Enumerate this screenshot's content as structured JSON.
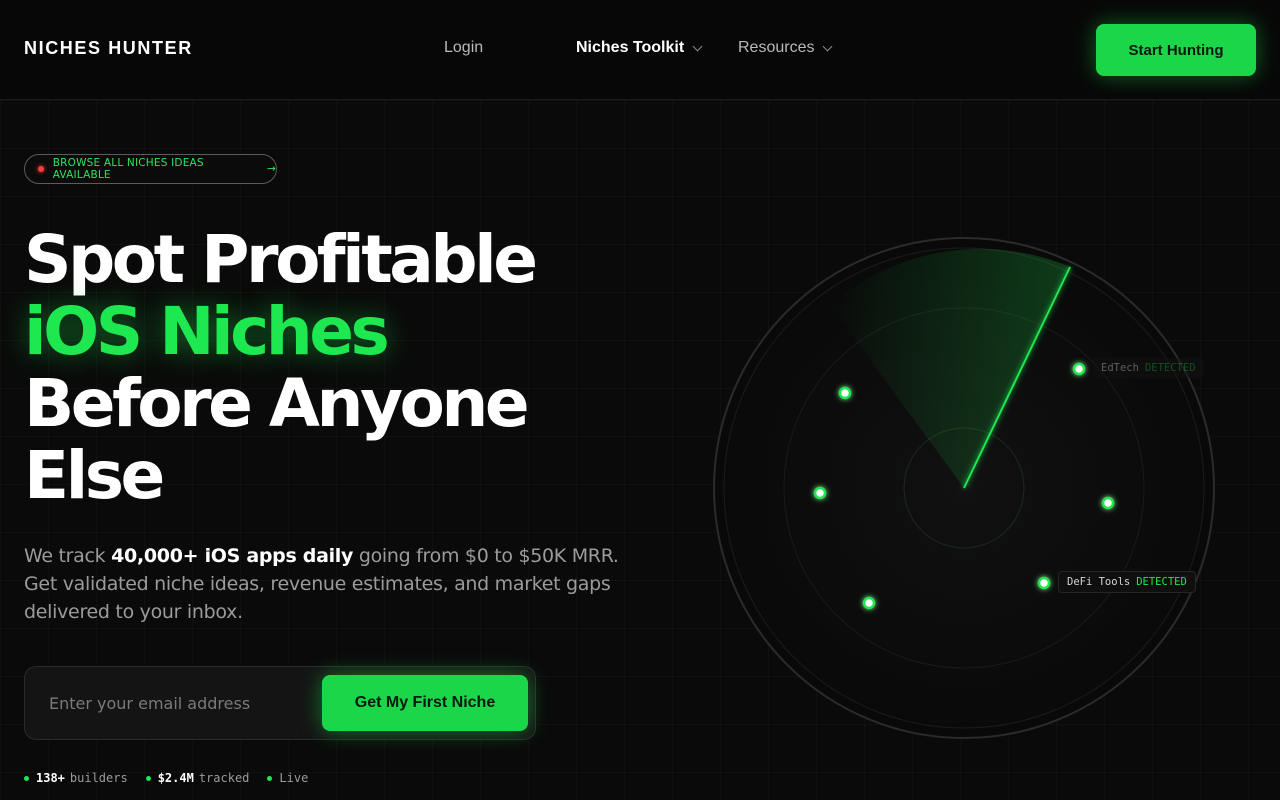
{
  "nav": {
    "logo": "NICHES HUNTER",
    "login": "Login",
    "toolkit": "Niches Toolkit",
    "resources": "Resources",
    "cta": "Start Hunting"
  },
  "badge": {
    "text": "BROWSE ALL NICHES IDEAS AVAILABLE",
    "arrow": "→"
  },
  "headline": {
    "line1": "Spot Profitable",
    "line2": "iOS Niches",
    "line3": "Before Anyone",
    "line4": "Else"
  },
  "subtext": {
    "pre": "We track ",
    "bold": "40,000+ iOS apps daily",
    "post": " going from $0 to $50K MRR. Get validated niche ideas, revenue estimates, and market gaps delivered to your inbox."
  },
  "form": {
    "placeholder": "Enter your email address",
    "cta": "Get My First Niche"
  },
  "stats": [
    {
      "value": "138+",
      "label": "builders"
    },
    {
      "value": "$2.4M",
      "label": "tracked"
    },
    {
      "value": "",
      "label": "Live"
    }
  ],
  "radar": {
    "labels": [
      {
        "name": "EdTech",
        "status": "DETECTED"
      },
      {
        "name": "DeFi Tools",
        "status": "DETECTED"
      }
    ]
  },
  "colors": {
    "accent": "#1cd64a",
    "background": "#0a0a0a",
    "alert": "#ff3b3b"
  }
}
